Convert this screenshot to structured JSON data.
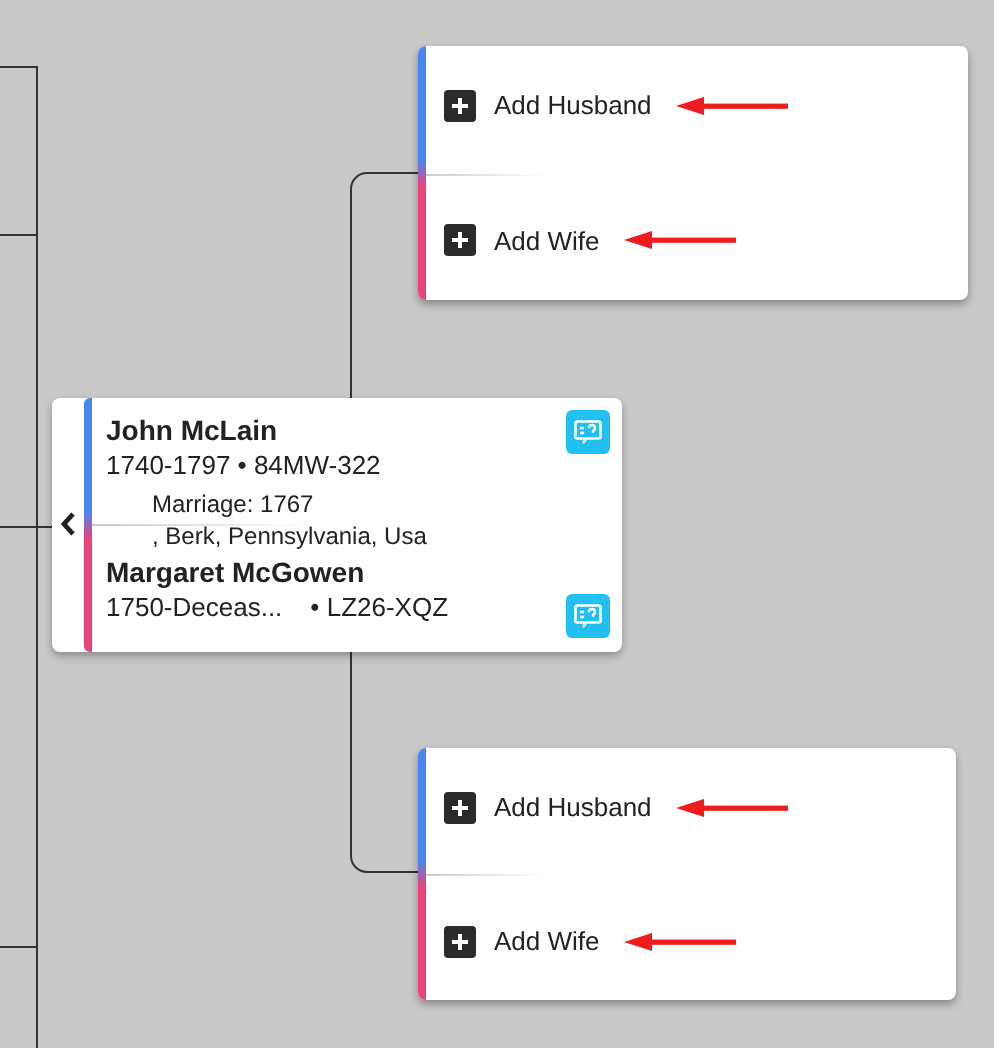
{
  "couple": {
    "husband": {
      "name": "John McLain",
      "details": "1740-1797 • 84MW-322"
    },
    "marriage": {
      "label": "Marriage: 1767",
      "place": ", Berk, Pennsylvania, Usa"
    },
    "wife": {
      "name": "Margaret McGowen",
      "years": "1750-Deceas...",
      "id": "• LZ26-XQZ"
    }
  },
  "parent_slots": [
    {
      "actions": [
        {
          "kind": "husband",
          "label": "Add Husband"
        },
        {
          "kind": "wife",
          "label": "Add Wife"
        }
      ]
    },
    {
      "actions": [
        {
          "kind": "husband",
          "label": "Add Husband"
        },
        {
          "kind": "wife",
          "label": "Add Wife"
        }
      ]
    }
  ]
}
